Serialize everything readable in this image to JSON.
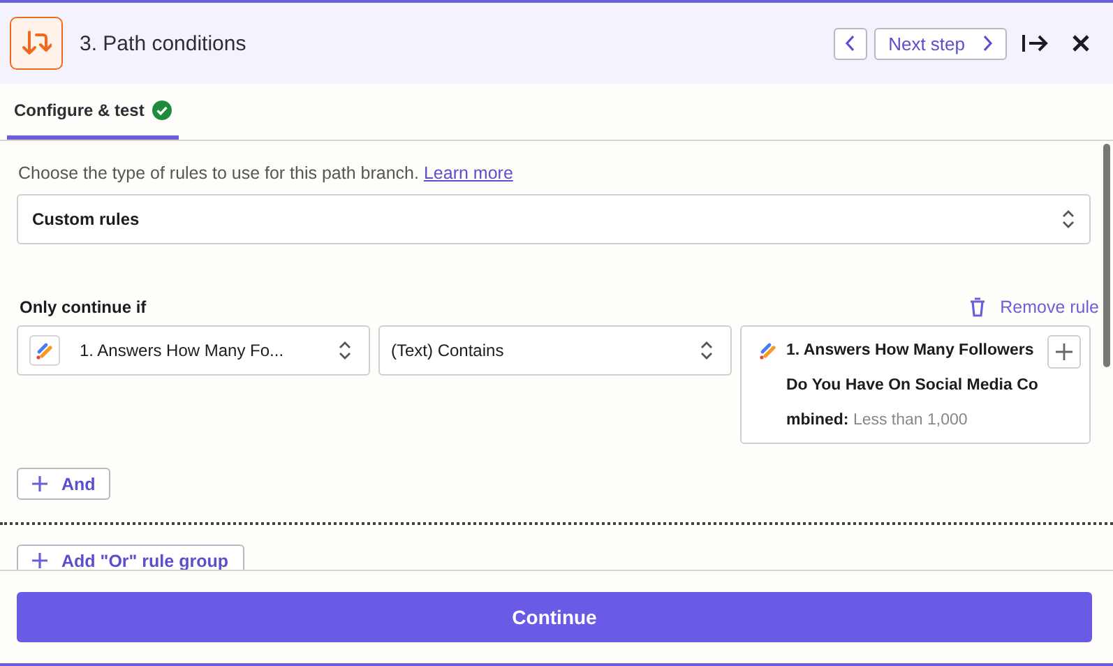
{
  "header": {
    "title": "3. Path conditions",
    "next_label": "Next step"
  },
  "tabs": [
    {
      "label": "Configure & test",
      "selected": true,
      "complete": true
    }
  ],
  "intro": {
    "text": "Choose the type of rules to use for this path branch.",
    "link": "Learn more"
  },
  "rule_type": {
    "value": "Custom rules"
  },
  "condition_group": {
    "title": "Only continue if",
    "remove_label": "Remove rule",
    "field": {
      "value": "1. Answers How Many Fo..."
    },
    "operator": {
      "value": "(Text) Contains"
    },
    "compare": {
      "label": "1. Answers How Many Followers Do You Have On Social Media Combined:",
      "value": "Less than 1,000"
    },
    "and_label": "And"
  },
  "or_group_label": "Add \"Or\" rule group",
  "footer": {
    "button": "Continue"
  }
}
